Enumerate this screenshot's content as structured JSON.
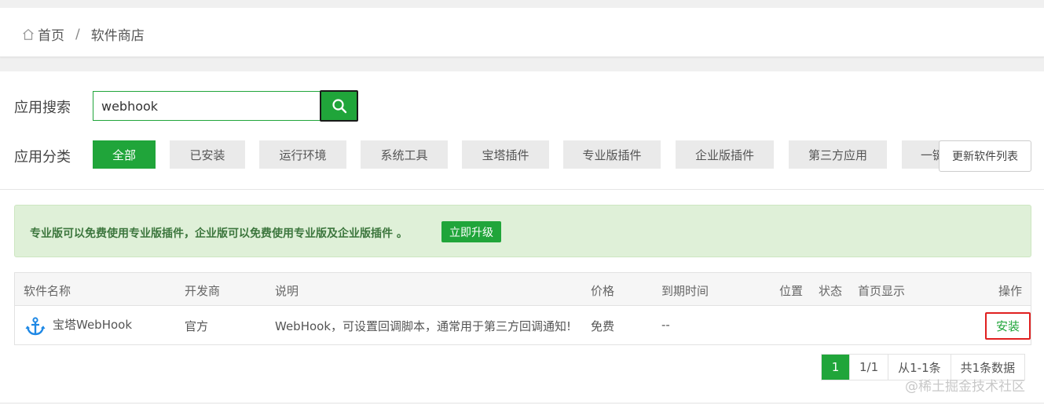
{
  "breadcrumb": {
    "home": "首页",
    "separator": "/",
    "current": "软件商店"
  },
  "search": {
    "label": "应用搜索",
    "value": "webhook",
    "placeholder": ""
  },
  "category": {
    "label": "应用分类",
    "items": [
      "全部",
      "已安装",
      "运行环境",
      "系统工具",
      "宝塔插件",
      "专业版插件",
      "企业版插件",
      "第三方应用",
      "一键"
    ],
    "active": "全部"
  },
  "refresh_label": "更新软件列表",
  "notice": {
    "text": "专业版可以免费使用专业版插件，企业版可以免费使用专业版及企业版插件 。",
    "upgrade_label": "立即升级"
  },
  "table": {
    "headers": [
      "软件名称",
      "开发商",
      "说明",
      "价格",
      "到期时间",
      "位置",
      "状态",
      "首页显示",
      "操作"
    ],
    "rows": [
      {
        "name": "宝塔WebHook",
        "developer": "官方",
        "desc": "WebHook，可设置回调脚本，通常用于第三方回调通知!",
        "price": "免费",
        "expire": "--",
        "action": "安装",
        "icon": "anchor-icon"
      }
    ]
  },
  "pager": {
    "current": "1",
    "pages": "1/1",
    "range": "从1-1条",
    "total": "共1条数据"
  },
  "watermark": "@稀土掘金技术社区",
  "colors": {
    "accent": "#20a53a",
    "highlight_border": "#e02020",
    "notice_bg": "#dff0d8"
  }
}
